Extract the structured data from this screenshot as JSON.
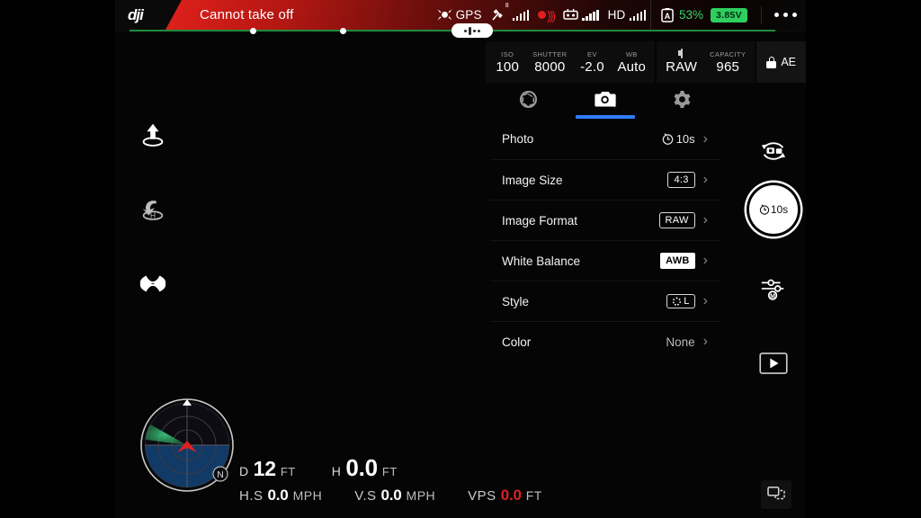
{
  "header": {
    "logo": "dji",
    "warning": "Cannot take off",
    "menu_icon": "more-dots-icon"
  },
  "status_bar": {
    "gps_icon": "drone-gps-icon",
    "gps_label": "GPS",
    "satellite_icon": "satellite-icon",
    "satellite_count": "8",
    "transmission_icon": "rc-signal-icon",
    "controller_icon": "remote-controller-icon",
    "hd_label": "HD",
    "battery_icon": "battery-auto-icon",
    "battery_percent": "53%",
    "battery_voltage": "3.85V",
    "voltage_color": "#2ecf5e",
    "percent_color": "#39d46a"
  },
  "camera_bar": {
    "cells": [
      {
        "key": "ISO",
        "value": "100"
      },
      {
        "key": "SHUTTER",
        "value": "8000"
      },
      {
        "key": "EV",
        "value": "-2.0"
      },
      {
        "key": "WB",
        "value": "Auto"
      }
    ],
    "storage_icon": "sd-card-icon",
    "format_value": "RAW",
    "capacity_key": "CAPACITY",
    "capacity_value": "965",
    "ae_lock_icon": "lock-icon",
    "ae_label": "AE"
  },
  "panel": {
    "tabs": [
      {
        "name": "exposure-tab",
        "icon": "aperture-icon",
        "active": false
      },
      {
        "name": "photo-tab",
        "icon": "camera-icon",
        "active": true
      },
      {
        "name": "settings-tab",
        "icon": "gear-icon",
        "active": false
      }
    ],
    "accent_color": "#2e7dfb",
    "rows": [
      {
        "label": "Photo",
        "value": "10s",
        "badge": "timer",
        "icon": "timer-icon"
      },
      {
        "label": "Image Size",
        "value": "4:3",
        "badge": "outline"
      },
      {
        "label": "Image Format",
        "value": "RAW",
        "badge": "outline"
      },
      {
        "label": "White Balance",
        "value": "AWB",
        "badge": "solid"
      },
      {
        "label": "Style",
        "value": "L",
        "badge": "style"
      },
      {
        "label": "Color",
        "value": "None",
        "badge": "text"
      }
    ]
  },
  "left_tools": [
    {
      "name": "takeoff-button",
      "icon": "takeoff-icon"
    },
    {
      "name": "return-home-button",
      "icon": "return-to-home-icon"
    },
    {
      "name": "drone-status-button",
      "icon": "drone-icon"
    }
  ],
  "right_sidebar": {
    "switch_mode": {
      "name": "camera-video-switch-button",
      "icon": "camera-video-switch-icon"
    },
    "shutter": {
      "name": "shutter-button",
      "icon": "timer-icon",
      "label": "10s"
    },
    "adjust": {
      "name": "camera-adjust-button",
      "icon": "sliders-manual-icon"
    },
    "playback": {
      "name": "playback-button",
      "icon": "play-icon"
    }
  },
  "radar": {
    "name": "attitude-radar",
    "north_label": "N",
    "cone_color": "#2ea35a",
    "aircraft_color": "#e01f1f",
    "ground_color": "#123a66"
  },
  "telemetry": {
    "distance": {
      "key": "D",
      "value": "12",
      "unit": "FT"
    },
    "height": {
      "key": "H",
      "value": "0.0",
      "unit": "FT"
    },
    "hspeed": {
      "key": "H.S",
      "value": "0.0",
      "unit": "MPH"
    },
    "vspeed": {
      "key": "V.S",
      "value": "0.0",
      "unit": "MPH"
    },
    "vps": {
      "key": "VPS",
      "value": "0.0",
      "unit": "FT",
      "color": "#e02020"
    }
  },
  "pip": {
    "name": "map-toggle-button",
    "icon": "picture-in-picture-icon"
  }
}
